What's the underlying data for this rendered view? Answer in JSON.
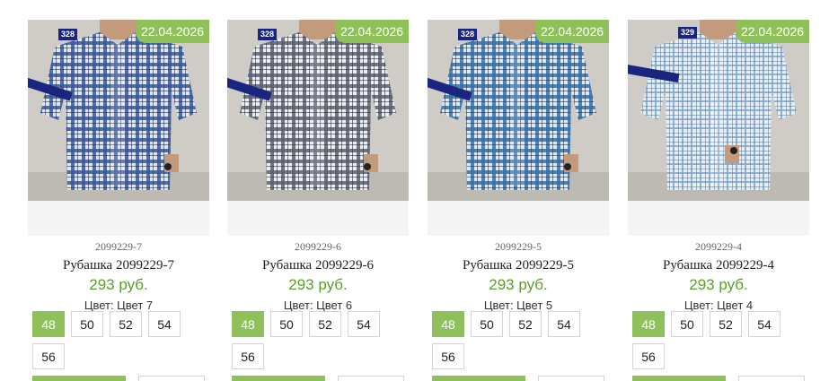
{
  "products": [
    {
      "date": "22.04.2026",
      "tag": "328",
      "sku": "2099229-7",
      "title": "Рубашка 2099229-7",
      "price": "293 руб.",
      "color_label": "Цвет: Цвет 7",
      "sizes": [
        "48",
        "50",
        "52",
        "54",
        "56"
      ],
      "active_size": "48",
      "plaid_color": "#3a5896"
    },
    {
      "date": "22.04.2026",
      "tag": "328",
      "sku": "2099229-6",
      "title": "Рубашка 2099229-6",
      "price": "293 руб.",
      "color_label": "Цвет: Цвет 6",
      "sizes": [
        "48",
        "50",
        "52",
        "54",
        "56"
      ],
      "active_size": "48",
      "plaid_color": "#59616f"
    },
    {
      "date": "22.04.2026",
      "tag": "328",
      "sku": "2099229-5",
      "title": "Рубашка 2099229-5",
      "price": "293 руб.",
      "color_label": "Цвет: Цвет 5",
      "sizes": [
        "48",
        "50",
        "52",
        "54",
        "56"
      ],
      "active_size": "48",
      "plaid_color": "#3a6ea3"
    },
    {
      "date": "22.04.2026",
      "tag": "329",
      "sku": "2099229-4",
      "title": "Рубашка 2099229-4",
      "price": "293 руб.",
      "color_label": "Цвет: Цвет 4",
      "sizes": [
        "48",
        "50",
        "52",
        "54",
        "56"
      ],
      "active_size": "48",
      "plaid_color": "#7fa2c6"
    }
  ],
  "colors": {
    "accent": "#8fc15a",
    "price": "#5a9e2c"
  }
}
